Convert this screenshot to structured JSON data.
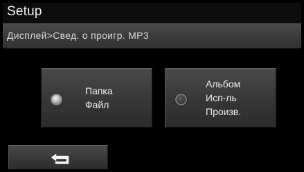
{
  "header": {
    "title": "Setup"
  },
  "breadcrumb": {
    "path": "Дисплей>Свед. о проигр. MP3"
  },
  "options": [
    {
      "lines": [
        "Папка",
        "Файл"
      ],
      "selected": true
    },
    {
      "lines": [
        "Альбом",
        "Исп-ль",
        "Произв."
      ],
      "selected": false
    }
  ],
  "footer": {
    "back_icon": "return-arrow-icon"
  },
  "colors": {
    "title_bg": "#0d0d0d",
    "panel_bg": "#3a3a3a",
    "text": "#efefef"
  }
}
